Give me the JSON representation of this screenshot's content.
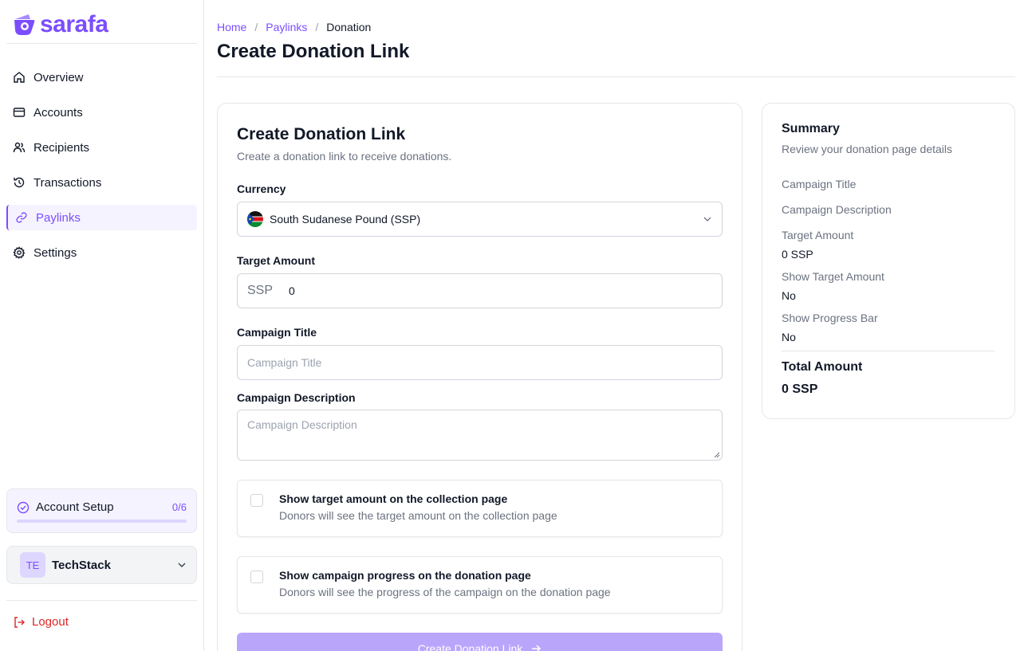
{
  "brand": {
    "name": "sarafa",
    "accent": "#7c4dff"
  },
  "sidebar": {
    "items": [
      {
        "label": "Overview",
        "icon": "home-icon",
        "active": false
      },
      {
        "label": "Accounts",
        "icon": "card-icon",
        "active": false
      },
      {
        "label": "Recipients",
        "icon": "users-icon",
        "active": false
      },
      {
        "label": "Transactions",
        "icon": "history-icon",
        "active": false
      },
      {
        "label": "Paylinks",
        "icon": "link-icon",
        "active": true
      },
      {
        "label": "Settings",
        "icon": "gear-icon",
        "active": false
      }
    ],
    "setup": {
      "label": "Account Setup",
      "count": "0/6",
      "progress": 0
    },
    "org": {
      "initials": "TE",
      "name": "TechStack"
    },
    "logout_label": "Logout"
  },
  "breadcrumb": {
    "home": "Home",
    "paylinks": "Paylinks",
    "current": "Donation"
  },
  "page_title": "Create Donation Link",
  "form": {
    "title": "Create Donation Link",
    "subtitle": "Create a donation link to receive donations.",
    "currency_label": "Currency",
    "currency_value": "South Sudanese Pound (SSP)",
    "target_label": "Target Amount",
    "target_prefix": "SSP",
    "target_value": "0",
    "title_label": "Campaign Title",
    "title_placeholder": "Campaign Title",
    "desc_label": "Campaign Description",
    "desc_placeholder": "Campaign Description",
    "option1_title": "Show target amount on the collection page",
    "option1_desc": "Donors will see the target amount on the collection page",
    "option2_title": "Show campaign progress on the donation page",
    "option2_desc": "Donors will see the progress of the campaign on the donation page",
    "submit_label": "Create Donation Link"
  },
  "summary": {
    "title": "Summary",
    "subtitle": "Review your donation page details",
    "campaign_title_label": "Campaign Title",
    "campaign_desc_label": "Campaign Description",
    "target_label": "Target Amount",
    "target_value": "0 SSP",
    "show_target_label": "Show Target Amount",
    "show_target_value": "No",
    "show_progress_label": "Show Progress Bar",
    "show_progress_value": "No",
    "total_label": "Total Amount",
    "total_value": "0 SSP"
  }
}
